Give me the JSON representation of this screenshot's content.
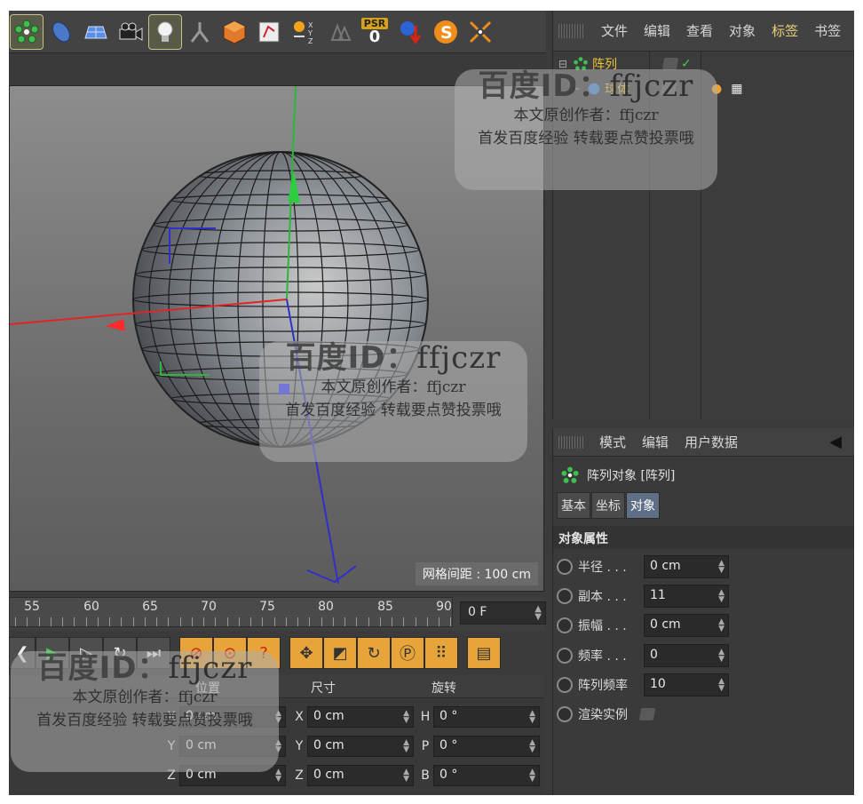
{
  "toolbar": {
    "psr_label": "PSR",
    "psr_value": "0"
  },
  "viewport": {
    "grid_label": "网格间距 : 100 cm"
  },
  "timeline": {
    "ruler_numbers": [
      "55",
      "60",
      "65",
      "70",
      "75",
      "80",
      "85",
      "90"
    ],
    "frame_value": "0 F"
  },
  "coords": {
    "headers": [
      "位置",
      "尺寸",
      "旋转"
    ],
    "rows": [
      {
        "pos_axis": "X",
        "pos": "0 cm",
        "size_axis": "X",
        "size": "0 cm",
        "rot_axis": "H",
        "rot": "0 °"
      },
      {
        "pos_axis": "Y",
        "pos": "0 cm",
        "size_axis": "Y",
        "size": "0 cm",
        "rot_axis": "P",
        "rot": "0 °"
      },
      {
        "pos_axis": "Z",
        "pos": "0 cm",
        "size_axis": "Z",
        "size": "0 cm",
        "rot_axis": "B",
        "rot": "0 °"
      }
    ]
  },
  "object_manager": {
    "menu": [
      "文件",
      "编辑",
      "查看",
      "对象",
      "标签",
      "书签"
    ],
    "objects": [
      {
        "name": "阵列",
        "icon": "array-icon"
      },
      {
        "name": "球体",
        "icon": "sphere-icon"
      }
    ]
  },
  "attribute_manager": {
    "menu": [
      "模式",
      "编辑",
      "用户数据"
    ],
    "title": "阵列对象 [阵列]",
    "tabs": [
      "基本",
      "坐标",
      "对象"
    ],
    "active_tab": "对象",
    "section": "对象属性",
    "params": [
      {
        "label": "半径 . . .",
        "value": "0 cm"
      },
      {
        "label": "副本 . . .",
        "value": "11"
      },
      {
        "label": "振幅 . . .",
        "value": "0 cm"
      },
      {
        "label": "频率 . . .",
        "value": "0"
      },
      {
        "label": "阵列频率",
        "value": "10"
      },
      {
        "label": "渲染实例",
        "value": ""
      }
    ]
  },
  "watermark": {
    "big_bold": "百度ID：",
    "big_light": "ffjczr",
    "line1": "本文原创作者：ffjczr",
    "line2": "首发百度经验 转载要点赞投票哦"
  },
  "colors": {
    "accent_yellow": "#e8c43a",
    "active_tab": "#5e6f86",
    "timeline_orange": "#e7a43a"
  }
}
